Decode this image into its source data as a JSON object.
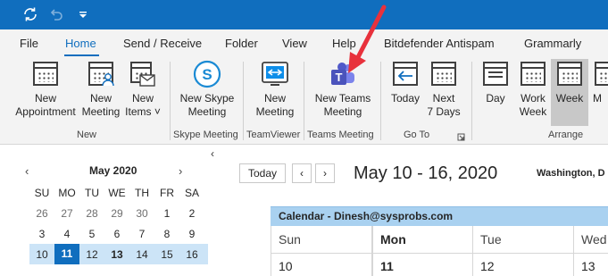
{
  "tabs": [
    "File",
    "Home",
    "Send / Receive",
    "Folder",
    "View",
    "Help",
    "Bitdefender Antispam",
    "Grammarly"
  ],
  "ribbon": {
    "new_appointment": [
      "New",
      "Appointment"
    ],
    "new_meeting": [
      "New",
      "Meeting"
    ],
    "new_items": [
      "New",
      "Items ˅"
    ],
    "new_skype_meeting": [
      "New Skype",
      "Meeting"
    ],
    "teamviewer_meeting": [
      "New",
      "Meeting"
    ],
    "new_teams_meeting": [
      "New Teams",
      "Meeting"
    ],
    "today": [
      "Today",
      ""
    ],
    "next_7_days": [
      "Next",
      "7 Days"
    ],
    "day": [
      "Day",
      ""
    ],
    "work_week": [
      "Work",
      "Week"
    ],
    "week": [
      "Week",
      ""
    ],
    "month": [
      "M",
      ""
    ],
    "groups": {
      "new": "New",
      "skype": "Skype Meeting",
      "teamviewer": "TeamViewer",
      "teams": "Teams Meeting",
      "goto": "Go To",
      "arrange": "Arrange"
    }
  },
  "mini_calendar": {
    "collapse": "‹",
    "prev": "‹",
    "next": "›",
    "title": "May 2020",
    "weekdays": [
      "SU",
      "MO",
      "TU",
      "WE",
      "TH",
      "FR",
      "SA"
    ],
    "rows": [
      [
        "26",
        "27",
        "28",
        "29",
        "30",
        "1",
        "2"
      ],
      [
        "3",
        "4",
        "5",
        "6",
        "7",
        "8",
        "9"
      ],
      [
        "10",
        "11",
        "12",
        "13",
        "14",
        "15",
        "16"
      ]
    ]
  },
  "main": {
    "today_button": "Today",
    "prev": "‹",
    "next": "›",
    "range_title": "May 10 - 16, 2020",
    "weather": "Washington, D",
    "calendar_name": "Calendar - Dinesh@sysprobs.com",
    "days": [
      {
        "name": "Sun",
        "date": "10"
      },
      {
        "name": "Mon",
        "date": "11"
      },
      {
        "name": "Tue",
        "date": "12"
      },
      {
        "name": "Wed",
        "date": "13"
      }
    ]
  }
}
